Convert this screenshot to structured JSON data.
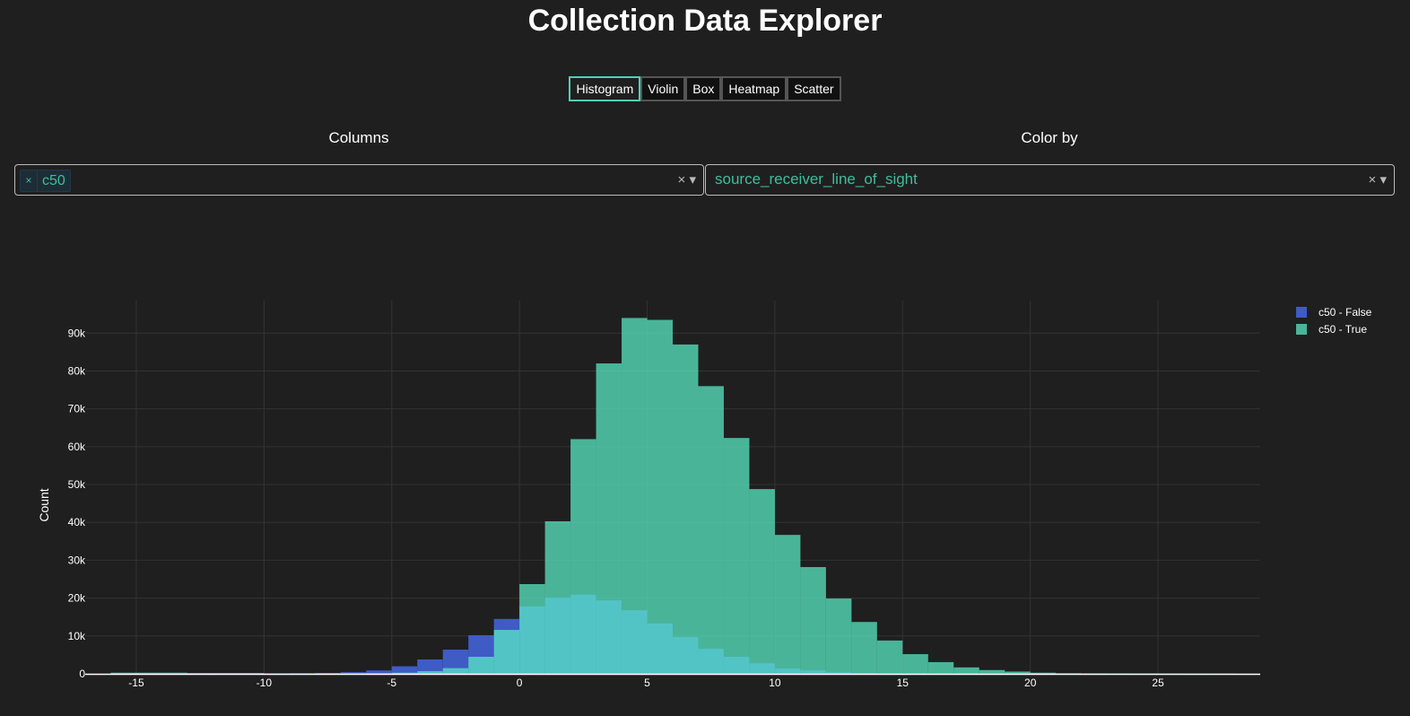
{
  "header": {
    "title": "Collection Data Explorer"
  },
  "tabs": [
    {
      "label": "Histogram",
      "active": true
    },
    {
      "label": "Violin"
    },
    {
      "label": "Box"
    },
    {
      "label": "Heatmap"
    },
    {
      "label": "Scatter"
    }
  ],
  "columns": {
    "label": "Columns",
    "chip_remove": "×",
    "selected": "c50",
    "clear": "×",
    "arrow": "▾"
  },
  "color_by": {
    "label": "Color by",
    "value": "source_receiver_line_of_sight",
    "clear": "×",
    "arrow": "▾"
  },
  "chart_data": {
    "type": "bar",
    "barmode": "overlay",
    "xlabel": "",
    "ylabel": "Count",
    "xlim": [
      -17,
      29
    ],
    "ylim": [
      0,
      98600
    ],
    "xticks": [
      -15,
      -10,
      -5,
      0,
      5,
      10,
      15,
      20,
      25
    ],
    "yticks": [
      {
        "v": 0,
        "l": "0"
      },
      {
        "v": 10000,
        "l": "10k"
      },
      {
        "v": 20000,
        "l": "20k"
      },
      {
        "v": 30000,
        "l": "30k"
      },
      {
        "v": 40000,
        "l": "40k"
      },
      {
        "v": 50000,
        "l": "50k"
      },
      {
        "v": 60000,
        "l": "60k"
      },
      {
        "v": 70000,
        "l": "70k"
      },
      {
        "v": 80000,
        "l": "80k"
      },
      {
        "v": 90000,
        "l": "90k"
      }
    ],
    "grid": true,
    "legend_position": "top-right",
    "bin_width": 1,
    "series": [
      {
        "name": "c50 - False",
        "color": "#3f5bc4",
        "bin_start": -16,
        "values": [
          50,
          50,
          50,
          50,
          50,
          50,
          50,
          150,
          250,
          450,
          900,
          2000,
          3800,
          6400,
          10200,
          14500,
          17800,
          20100,
          20900,
          19400,
          16800,
          13300,
          9700,
          6600,
          4500,
          2800,
          1400,
          900,
          400,
          200,
          100,
          50,
          0,
          0,
          0,
          0,
          0,
          0,
          0,
          0,
          0,
          0,
          0,
          0
        ]
      },
      {
        "name": "c50 - True",
        "color": "#5aecc7",
        "opacity": 0.73,
        "bin_start": -16,
        "values": [
          300,
          300,
          300,
          200,
          200,
          200,
          100,
          100,
          100,
          100,
          150,
          300,
          700,
          1500,
          4500,
          11600,
          23700,
          40300,
          62000,
          82000,
          94000,
          93500,
          87000,
          76000,
          62300,
          48800,
          36700,
          28200,
          19900,
          13700,
          8800,
          5200,
          3100,
          1700,
          1000,
          600,
          300,
          150,
          100,
          80,
          60,
          50,
          40,
          30
        ]
      }
    ]
  }
}
